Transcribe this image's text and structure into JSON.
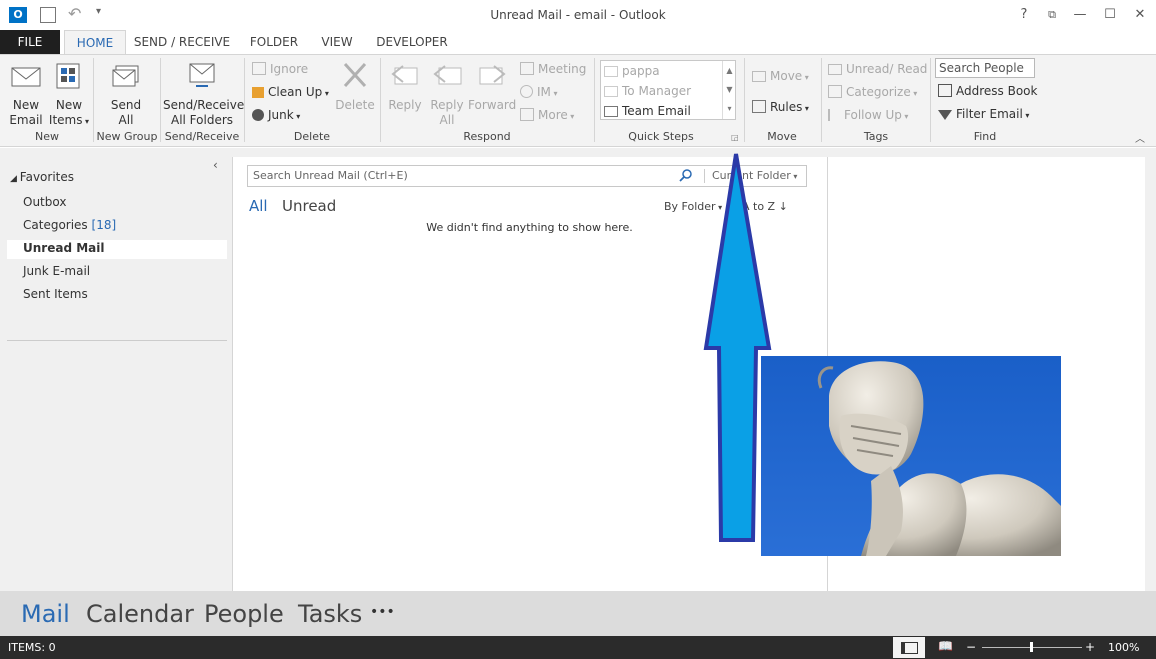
{
  "window": {
    "title": "Unread Mail - email - Outlook",
    "app_icon": "O",
    "controls": {
      "help": "?",
      "ribbon_options": "⧉",
      "minimize": "—",
      "maximize": "☐",
      "close": "✕"
    }
  },
  "tabs": [
    "FILE",
    "HOME",
    "SEND / RECEIVE",
    "FOLDER",
    "VIEW",
    "DEVELOPER"
  ],
  "ribbon": {
    "new": {
      "new_email_1": "New",
      "new_email_2": "Email",
      "new_items_1": "New",
      "new_items_2": "Items",
      "group": "New"
    },
    "new_group": {
      "send_all_1": "Send",
      "send_all_2": "All",
      "group": "New Group"
    },
    "send_receive": {
      "label_1": "Send/Receive",
      "label_2": "All Folders",
      "group": "Send/Receive"
    },
    "delete": {
      "ignore": "Ignore",
      "clean_up": "Clean Up",
      "junk": "Junk",
      "delete": "Delete",
      "group": "Delete"
    },
    "respond": {
      "reply": "Reply",
      "reply_all_1": "Reply",
      "reply_all_2": "All",
      "forward": "Forward",
      "meeting": "Meeting",
      "im": "IM",
      "more": "More",
      "group": "Respond"
    },
    "quick_steps": {
      "items": [
        "pappa",
        "To Manager",
        "Team Email"
      ],
      "group": "Quick Steps"
    },
    "move": {
      "move": "Move",
      "rules": "Rules",
      "group": "Move"
    },
    "tags": {
      "unread_read": "Unread/ Read",
      "categorize": "Categorize",
      "follow_up": "Follow Up",
      "group": "Tags"
    },
    "find": {
      "search_people": "Search People",
      "address_book": "Address Book",
      "filter_email": "Filter Email",
      "group": "Find"
    }
  },
  "folders": {
    "favorites": "Favorites",
    "outbox": "Outbox",
    "categories": "Categories",
    "categories_count": "[18]",
    "unread_mail": "Unread Mail",
    "junk": "Junk E-mail",
    "sent": "Sent Items"
  },
  "mail_list": {
    "search_placeholder": "Search Unread Mail (Ctrl+E)",
    "scope": "Current Folder",
    "filter_all": "All",
    "filter_unread": "Unread",
    "sort_by": "By Folder",
    "sort_order": "A to Z",
    "empty_message": "We didn't find anything to show here."
  },
  "nav": {
    "mail": "Mail",
    "calendar": "Calendar",
    "people": "People",
    "tasks": "Tasks",
    "more": "•••"
  },
  "status": {
    "items": "ITEMS: 0",
    "zoom": "100%"
  },
  "colors": {
    "accent": "#2a6ab3",
    "arrow_fill": "#0aa0e6",
    "arrow_stroke": "#2b3aa8",
    "sky": "#1a5fc8"
  }
}
